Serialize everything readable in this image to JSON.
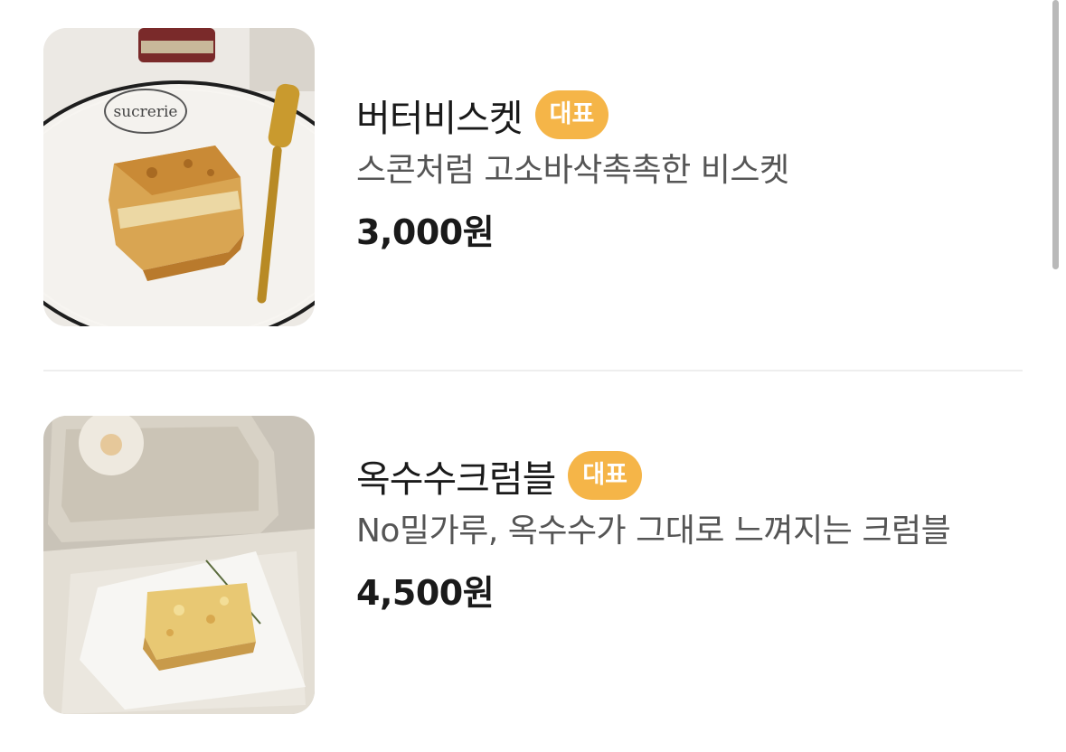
{
  "items": [
    {
      "name": "버터비스켓",
      "badge": "대표",
      "description": "스콘처럼 고소바삭촉촉한 비스켓",
      "price": "3,000원",
      "image": "butter-biscuit-photo",
      "plate_text": "sucrerie"
    },
    {
      "name": "옥수수크럼블",
      "badge": "대표",
      "description": "No밀가루, 옥수수가 그대로 느껴지는 크럼블",
      "price": "4,500원",
      "image": "corn-crumble-photo"
    }
  ],
  "colors": {
    "badge_bg": "#f5b548",
    "badge_text": "#ffffff",
    "title": "#1a1a1a",
    "description": "#555555",
    "divider": "#eeeeee"
  }
}
